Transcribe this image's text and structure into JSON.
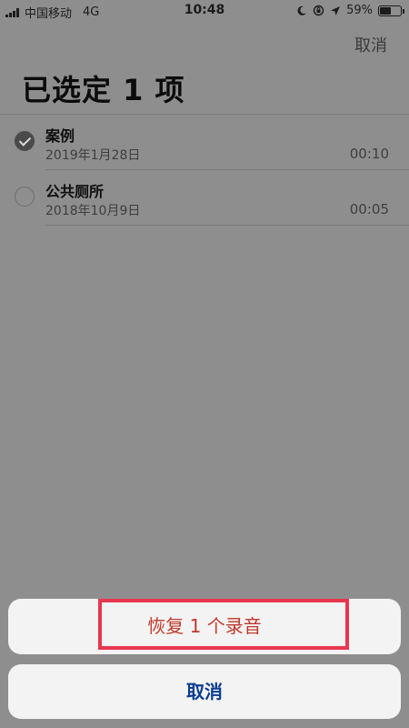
{
  "status_bar": {
    "carrier": "中国移动",
    "network": "4G",
    "time": "10:48",
    "battery": "59%",
    "battery_level": 0.59,
    "icons": [
      "signal-icon",
      "moon-icon",
      "rotation-lock-icon",
      "location-arrow-icon",
      "battery-icon"
    ]
  },
  "header": {
    "cancel_label": "取消",
    "title": "已选定 1 项"
  },
  "recordings": [
    {
      "name": "案例",
      "date": "2019年1月28日",
      "duration": "00:10",
      "selected": true
    },
    {
      "name": "公共厕所",
      "date": "2018年10月9日",
      "duration": "00:05",
      "selected": false
    }
  ],
  "action_sheet": {
    "restore_label": "恢复 1 个录音",
    "cancel_label": "取消"
  },
  "colors": {
    "dim_background": "#8e8e8e",
    "destructive_red": "#c0392b",
    "action_blue": "#0a3d91",
    "highlight_box": "#e8364f"
  }
}
